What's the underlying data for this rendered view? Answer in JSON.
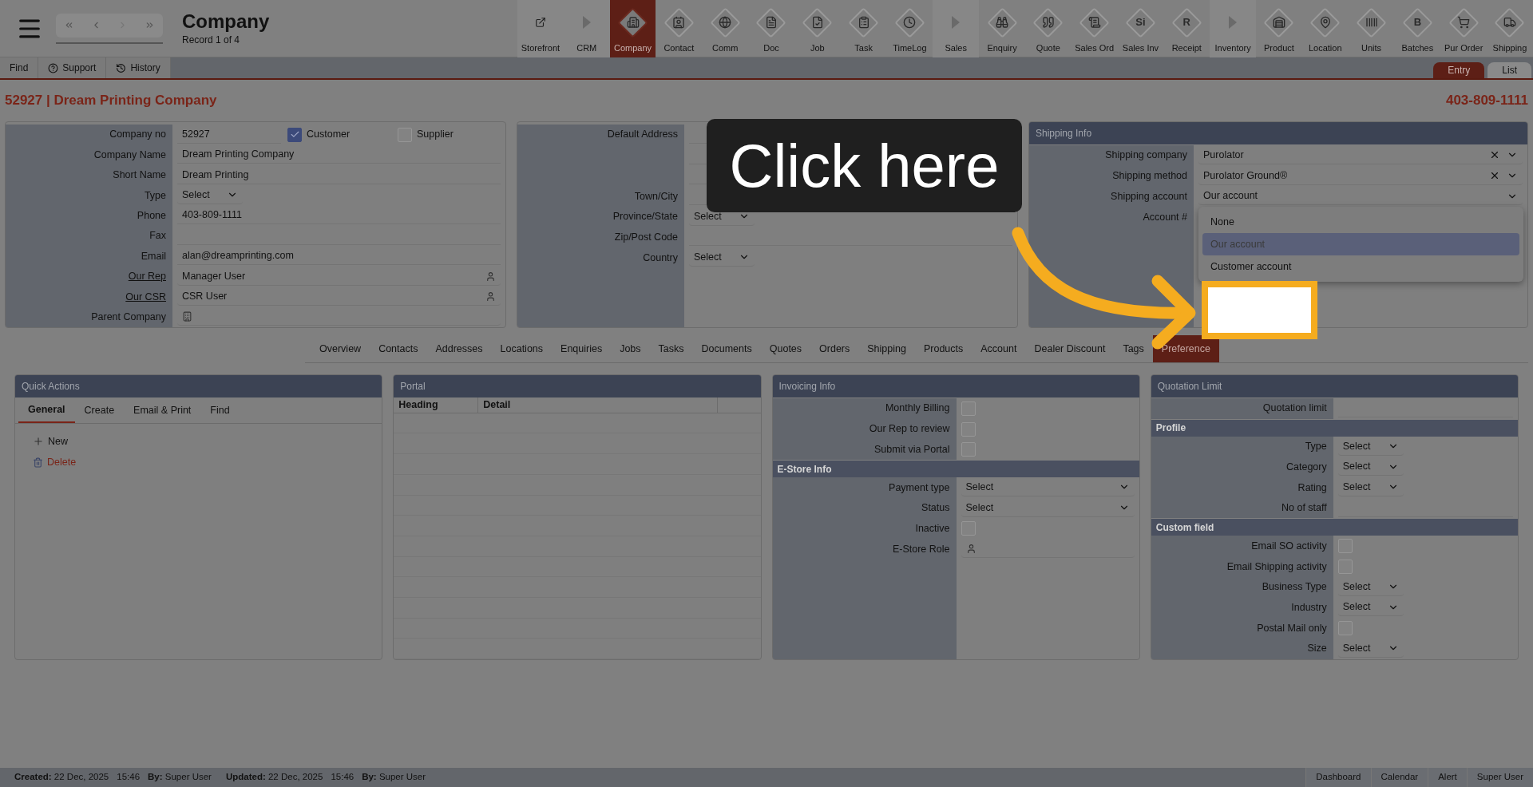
{
  "top_bar": {
    "title": "Company",
    "subtitle": "Record 1 of 4",
    "modules": [
      {
        "label": "Storefront",
        "kind": "link",
        "selected": false
      },
      {
        "label": "CRM",
        "kind": "section",
        "selected": false
      },
      {
        "label": "Company",
        "kind": "module",
        "selected": true
      },
      {
        "label": "Contact",
        "kind": "module",
        "selected": false
      },
      {
        "label": "Comm",
        "kind": "module",
        "selected": false
      },
      {
        "label": "Doc",
        "kind": "module",
        "selected": false
      },
      {
        "label": "Job",
        "kind": "module",
        "selected": false
      },
      {
        "label": "Task",
        "kind": "module",
        "selected": false
      },
      {
        "label": "TimeLog",
        "kind": "module",
        "selected": false
      },
      {
        "label": "Sales",
        "kind": "section",
        "selected": false
      },
      {
        "label": "Enquiry",
        "kind": "module",
        "selected": false
      },
      {
        "label": "Quote",
        "kind": "module",
        "selected": false
      },
      {
        "label": "Sales Ord",
        "kind": "module",
        "selected": false
      },
      {
        "label": "Sales Inv",
        "kind": "module",
        "selected": false,
        "glyph": "Si"
      },
      {
        "label": "Receipt",
        "kind": "module",
        "selected": false,
        "glyph": "R"
      },
      {
        "label": "Inventory",
        "kind": "section",
        "selected": false
      },
      {
        "label": "Product",
        "kind": "module",
        "selected": false
      },
      {
        "label": "Location",
        "kind": "module",
        "selected": false
      },
      {
        "label": "Units",
        "kind": "module",
        "selected": false
      },
      {
        "label": "Batches",
        "kind": "module",
        "selected": false,
        "glyph": "B"
      },
      {
        "label": "Pur Order",
        "kind": "module",
        "selected": false
      },
      {
        "label": "Shipping",
        "kind": "module",
        "selected": false
      }
    ]
  },
  "sub_bar": {
    "buttons": [
      {
        "label": "Find",
        "kind": "plain"
      },
      {
        "label": "Support",
        "kind": "help"
      },
      {
        "label": "History",
        "kind": "history"
      }
    ],
    "view_tabs": [
      {
        "label": "Entry",
        "selected": true
      },
      {
        "label": "List",
        "selected": false
      }
    ]
  },
  "record": {
    "title": "52927 | Dream Printing Company",
    "phone": "403-809-1111"
  },
  "company_panel": {
    "rows": [
      {
        "label": "Company no",
        "kind": "flags",
        "value": "52927",
        "flags": [
          {
            "label": "Customer",
            "checked": true
          },
          {
            "label": "Supplier",
            "checked": false
          }
        ]
      },
      {
        "label": "Company Name",
        "kind": "text",
        "value": "Dream Printing Company"
      },
      {
        "label": "Short Name",
        "kind": "text",
        "value": "Dream Printing"
      },
      {
        "label": "Type",
        "kind": "select",
        "value": "Select"
      },
      {
        "label": "Phone",
        "kind": "text",
        "value": "403-809-1111"
      },
      {
        "label": "Fax",
        "kind": "text"
      },
      {
        "label": "Email",
        "kind": "text",
        "value": "alan@dreamprinting.com"
      },
      {
        "label": "Our Rep",
        "kind": "person_lookup",
        "value": "Manager User",
        "link": true
      },
      {
        "label": "Our CSR",
        "kind": "person_lookup",
        "value": "CSR User",
        "link": true
      },
      {
        "label": "Parent Company",
        "kind": "company_lookup"
      }
    ]
  },
  "address_panel": {
    "rows": [
      {
        "label": "Default Address",
        "kind": "text"
      },
      {
        "kind": "text"
      },
      {
        "kind": "text"
      },
      {
        "label": "Town/City",
        "kind": "text"
      },
      {
        "label": "Province/State",
        "kind": "select",
        "value": "Select"
      },
      {
        "label": "Zip/Post Code",
        "kind": "text"
      },
      {
        "label": "Country",
        "kind": "select",
        "value": "Select"
      }
    ]
  },
  "shipping_panel": {
    "title": "Shipping Info",
    "rows": [
      {
        "label": "Shipping company",
        "kind": "clearable_select",
        "value": "Purolator"
      },
      {
        "label": "Shipping method",
        "kind": "clearable_select",
        "value": "Purolator Ground®"
      },
      {
        "label": "Shipping account",
        "kind": "select_wide",
        "value": "Our account"
      },
      {
        "label": "Account #",
        "kind": "text"
      }
    ],
    "dropdown": [
      {
        "label": "None",
        "selected": false
      },
      {
        "label": "Our account",
        "selected": true
      },
      {
        "label": "Customer account",
        "selected": false
      }
    ]
  },
  "detail_tabs": [
    {
      "label": "Overview",
      "selected": false
    },
    {
      "label": "Contacts",
      "selected": false
    },
    {
      "label": "Addresses",
      "selected": false
    },
    {
      "label": "Locations",
      "selected": false
    },
    {
      "label": "Enquiries",
      "selected": false
    },
    {
      "label": "Jobs",
      "selected": false
    },
    {
      "label": "Tasks",
      "selected": false
    },
    {
      "label": "Documents",
      "selected": false
    },
    {
      "label": "Quotes",
      "selected": false
    },
    {
      "label": "Orders",
      "selected": false
    },
    {
      "label": "Shipping",
      "selected": false
    },
    {
      "label": "Products",
      "selected": false
    },
    {
      "label": "Account",
      "selected": false
    },
    {
      "label": "Dealer Discount",
      "selected": false
    },
    {
      "label": "Tags",
      "selected": false
    },
    {
      "label": "Preference",
      "selected": true
    }
  ],
  "quick_actions": {
    "title": "Quick Actions",
    "tabs": [
      {
        "label": "General",
        "selected": true
      },
      {
        "label": "Create",
        "selected": false
      },
      {
        "label": "Email & Print",
        "selected": false
      },
      {
        "label": "Find",
        "selected": false
      }
    ],
    "actions": [
      {
        "label": "New",
        "kind": "add"
      },
      {
        "label": "Delete",
        "kind": "delete"
      }
    ]
  },
  "portal": {
    "title": "Portal",
    "columns": [
      "Heading",
      "Detail"
    ]
  },
  "invoicing": {
    "title": "Invoicing Info",
    "sections": [
      {
        "rows": [
          {
            "label": "Monthly Billing",
            "kind": "checkbox",
            "checked": false
          },
          {
            "label": "Our Rep to review",
            "kind": "checkbox",
            "checked": false
          },
          {
            "label": "Submit via Portal",
            "kind": "checkbox",
            "checked": false
          }
        ]
      },
      {
        "heading": "E-Store Info",
        "rows": [
          {
            "label": "Payment type",
            "kind": "select_wide",
            "value": "Select"
          },
          {
            "label": "Status",
            "kind": "select_wide",
            "value": "Select"
          },
          {
            "label": "Inactive",
            "kind": "checkbox",
            "checked": false
          },
          {
            "label": "E-Store Role",
            "kind": "person_lookup"
          }
        ]
      }
    ]
  },
  "quotation": {
    "title": "Quotation Limit",
    "sections": [
      {
        "rows": [
          {
            "label": "Quotation limit",
            "kind": "text"
          }
        ]
      },
      {
        "heading": "Profile",
        "rows": [
          {
            "label": "Type",
            "kind": "select",
            "value": "Select"
          },
          {
            "label": "Category",
            "kind": "select",
            "value": "Select"
          },
          {
            "label": "Rating",
            "kind": "select",
            "value": "Select"
          },
          {
            "label": "No of staff",
            "kind": "text"
          }
        ]
      },
      {
        "heading": "Custom field",
        "rows": [
          {
            "label": "Email SO activity",
            "kind": "checkbox",
            "checked": false
          },
          {
            "label": "Email Shipping activity",
            "kind": "checkbox",
            "checked": false
          },
          {
            "label": "Business Type",
            "kind": "select",
            "value": "Select"
          },
          {
            "label": "Industry",
            "kind": "select",
            "value": "Select"
          },
          {
            "label": "Postal Mail only",
            "kind": "checkbox",
            "checked": false
          },
          {
            "label": "Size",
            "kind": "select",
            "value": "Select"
          }
        ]
      }
    ]
  },
  "status_bar": {
    "info": [
      "**Created:** 22 Dec, 2025",
      "15:46",
      "**By:** Super User",
      "**Updated:** 22 Dec, 2025",
      "15:46",
      "**By:** Super User"
    ],
    "buttons": [
      "Dashboard",
      "Calendar",
      "Alert",
      "Super User"
    ]
  },
  "callout": {
    "text": "Click here"
  }
}
